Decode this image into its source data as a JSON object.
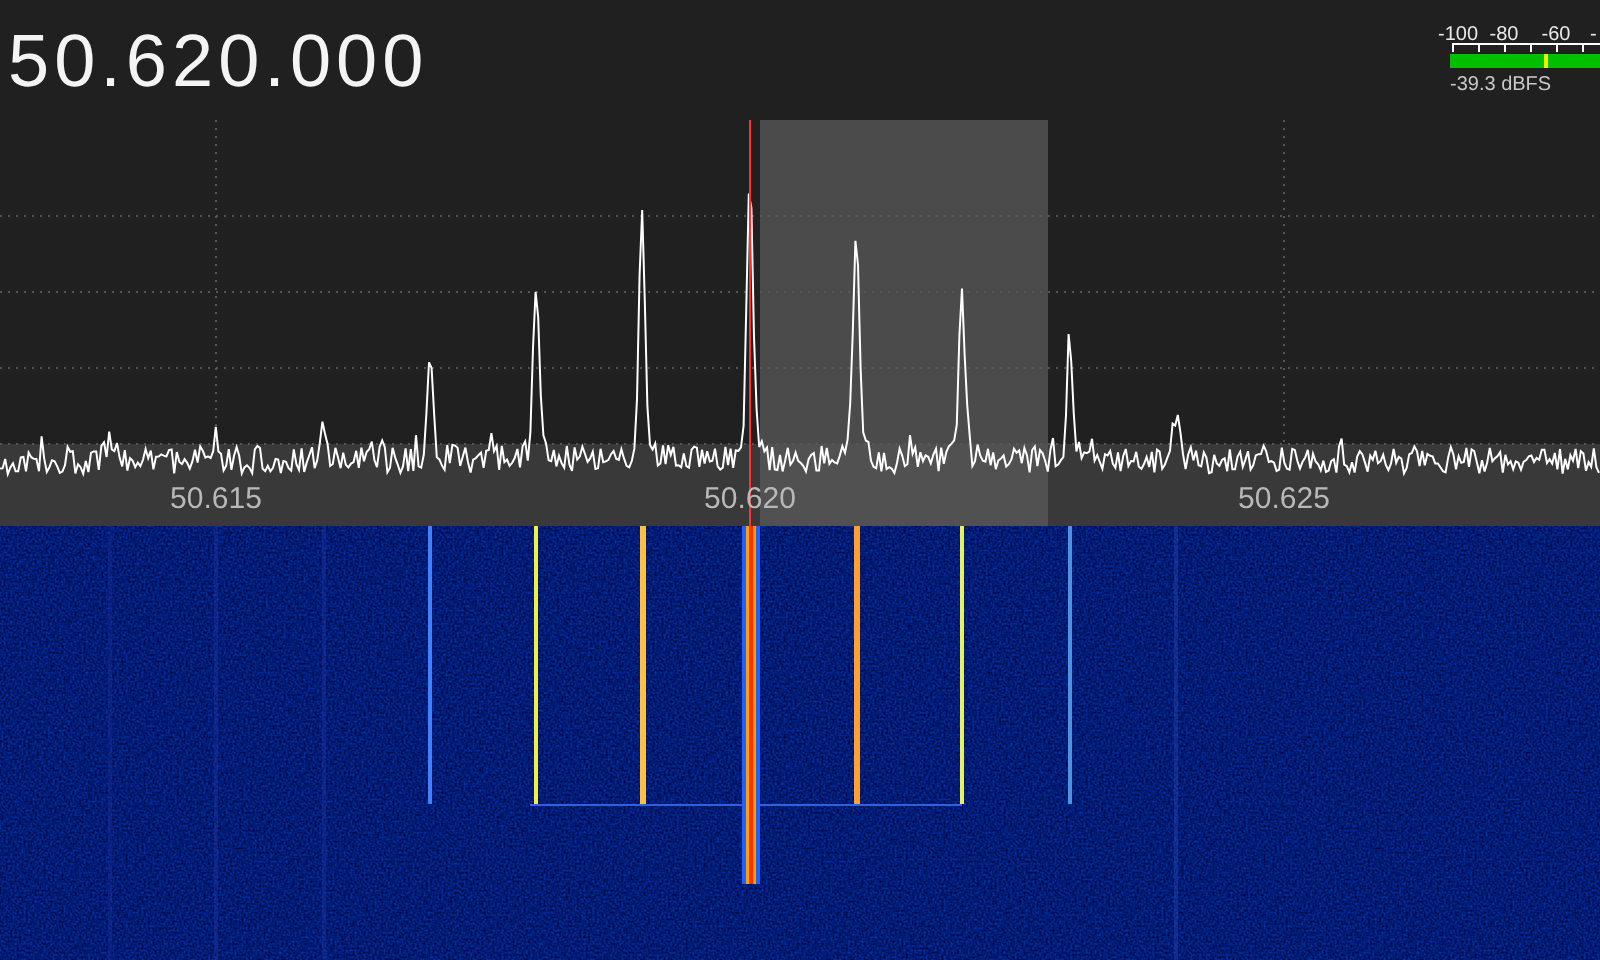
{
  "frequency_display": "50.620.000",
  "signal_meter": {
    "scale_labels": [
      "-100",
      "-80",
      "-60",
      "-"
    ],
    "marker": {
      "level": 0.63
    },
    "reading": "-39.3 dBFS"
  },
  "spectrum": {
    "axis_labels": [
      "50.615",
      "50.620",
      "50.625"
    ]
  }
}
